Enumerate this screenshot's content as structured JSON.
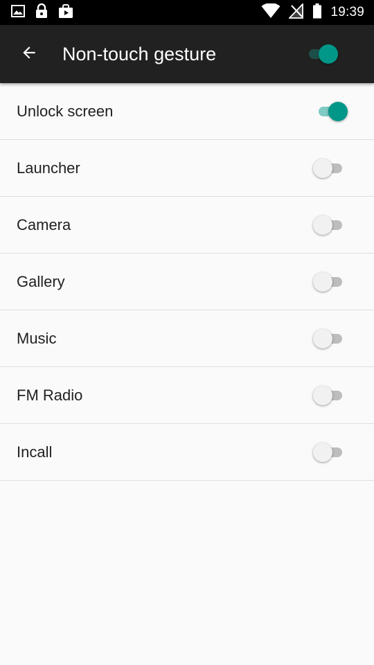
{
  "status_bar": {
    "time": "19:39",
    "left_icons": [
      "image-icon",
      "lock-icon",
      "shopping-bag-icon"
    ],
    "right_icons": [
      "wifi-icon",
      "no-signal-icon",
      "battery-icon"
    ]
  },
  "app_bar": {
    "title": "Non-touch gesture",
    "master_enabled": true
  },
  "settings": [
    {
      "label": "Unlock screen",
      "enabled": true
    },
    {
      "label": "Launcher",
      "enabled": false
    },
    {
      "label": "Camera",
      "enabled": false
    },
    {
      "label": "Gallery",
      "enabled": false
    },
    {
      "label": "Music",
      "enabled": false
    },
    {
      "label": "FM Radio",
      "enabled": false
    },
    {
      "label": "Incall",
      "enabled": false
    }
  ],
  "colors": {
    "accent": "#009688",
    "accent_track": "#80cbc4",
    "toolbar": "#212121",
    "status_bar": "#000000",
    "background": "#fafafa"
  }
}
